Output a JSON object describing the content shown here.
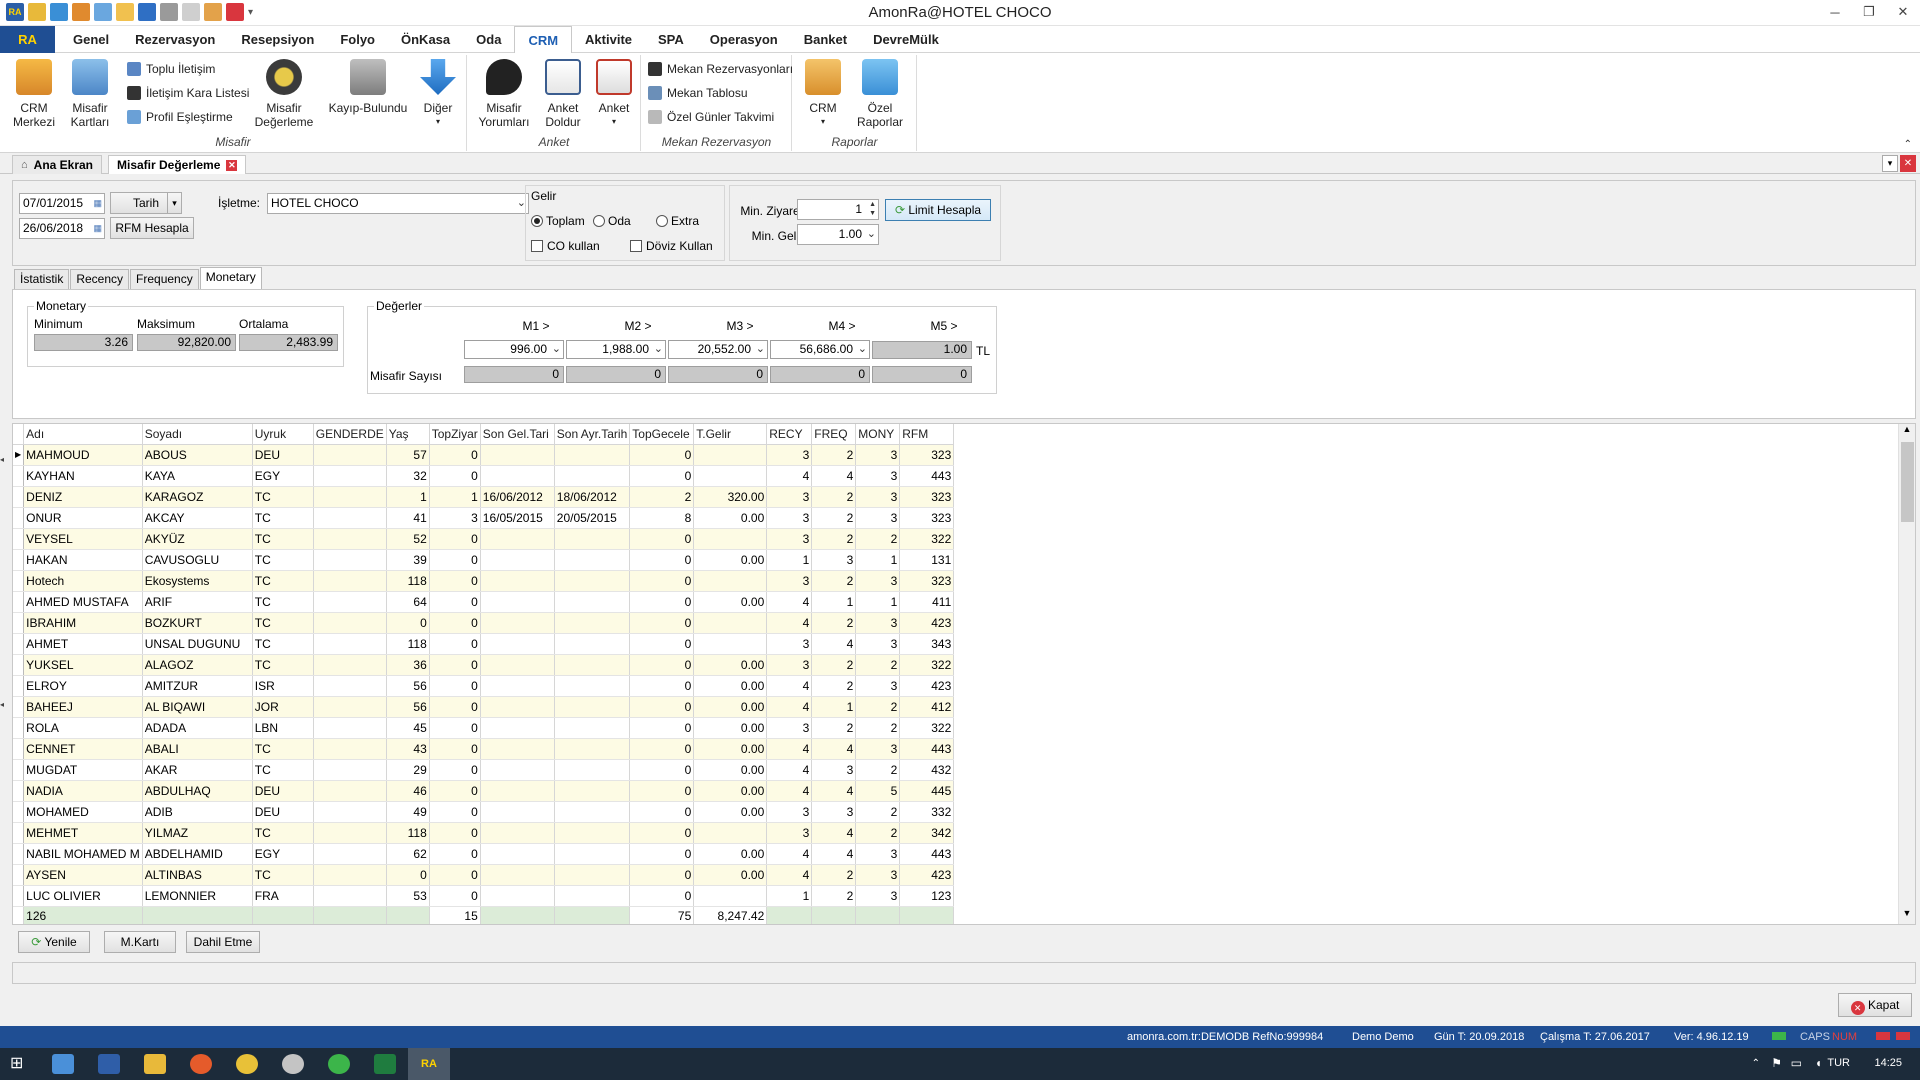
{
  "window": {
    "title": "AmonRa@HOTEL CHOCO",
    "app_logo": "RA"
  },
  "ribbon_tabs": [
    "Genel",
    "Rezervasyon",
    "Resepsiyon",
    "Folyo",
    "ÖnKasa",
    "Oda",
    "CRM",
    "Aktivite",
    "SPA",
    "Operasyon",
    "Banket",
    "DevreMülk"
  ],
  "active_tab": "CRM",
  "ribbon": {
    "misafir": {
      "label": "Misafir",
      "crm_merkezi": "CRM\nMerkezi",
      "misafir_kartlari": "Misafir\nKartları",
      "toplu_iletisim": "Toplu İletişim",
      "kara_liste": "İletişim Kara Listesi",
      "profil": "Profil Eşleştirme",
      "degerleme": "Misafir\nDeğerleme",
      "kayip": "Kayıp-Bulundu",
      "diger": "Diğer"
    },
    "anket": {
      "label": "Anket",
      "yorumlari": "Misafir\nYorumları",
      "doldur": "Anket\nDoldur",
      "anket": "Anket"
    },
    "mekan": {
      "label": "Mekan Rezervasyon",
      "rezervasyonlari": "Mekan Rezervasyonları",
      "tablosu": "Mekan Tablosu",
      "takvim": "Özel Günler Takvimi"
    },
    "raporlar": {
      "label": "Raporlar",
      "crm": "CRM",
      "ozel": "Özel\nRaporlar"
    }
  },
  "doc_tabs": {
    "home": "Ana Ekran",
    "current": "Misafir Değerleme"
  },
  "filter": {
    "date_from": "07/01/2015",
    "date_to": "26/06/2018",
    "date_type": "Tarih",
    "rfm_button": "RFM Hesapla",
    "isletme_label": "İşletme:",
    "isletme_value": "HOTEL CHOCO",
    "gelir_label": "Gelir",
    "gelir_options": [
      "Toplam",
      "Oda",
      "Extra"
    ],
    "gelir_selected": "Toplam",
    "co_kullan": "CO kullan",
    "doviz_kullan": "Döviz Kullan",
    "min_ziyaret_label": "Min. Ziyaret",
    "min_ziyaret": "1",
    "min_gelir_label": "Min. Gelir",
    "min_gelir": "1.00",
    "limit_button": "Limit Hesapla"
  },
  "sub_tabs": [
    "İstatistik",
    "Recency",
    "Frequency",
    "Monetary"
  ],
  "active_sub_tab": "Monetary",
  "monetary": {
    "title": "Monetary",
    "labels": [
      "Minimum",
      "Maksimum",
      "Ortalama"
    ],
    "values": [
      "3.26",
      "92,820.00",
      "2,483.99"
    ]
  },
  "degerler": {
    "title": "Değerler",
    "headers": [
      "M1 >",
      "M2 >",
      "M3 >",
      "M4 >",
      "M5 >"
    ],
    "thresholds": [
      "996.00",
      "1,988.00",
      "20,552.00",
      "56,686.00",
      "1.00"
    ],
    "currency": "TL",
    "count_label": "Misafir Sayısı",
    "counts": [
      "0",
      "0",
      "0",
      "0",
      "0"
    ]
  },
  "grid": {
    "columns": [
      "Adı",
      "Soyadı",
      "Uyruk",
      "GENDERDE",
      "Yaş",
      "TopZiyar",
      "Son Gel.Tari",
      "Son Ayr.Tarih",
      "TopGecele",
      "T.Gelir",
      "RECY",
      "FREQ",
      "MONY",
      "RFM"
    ],
    "rows": [
      [
        "MAHMOUD",
        "ABOUS",
        "DEU",
        "",
        "57",
        "0",
        "",
        "",
        "0",
        "",
        "3",
        "2",
        "3",
        "323"
      ],
      [
        "KAYHAN",
        "KAYA",
        "EGY",
        "",
        "32",
        "0",
        "",
        "",
        "0",
        "",
        "4",
        "4",
        "3",
        "443"
      ],
      [
        "DENIZ",
        "KARAGOZ",
        "TC",
        "",
        "1",
        "1",
        "16/06/2012",
        "18/06/2012",
        "2",
        "320.00",
        "3",
        "2",
        "3",
        "323"
      ],
      [
        "ONUR",
        "AKCAY",
        "TC",
        "",
        "41",
        "3",
        "16/05/2015",
        "20/05/2015",
        "8",
        "0.00",
        "3",
        "2",
        "3",
        "323"
      ],
      [
        "VEYSEL",
        "AKYÜZ",
        "TC",
        "",
        "52",
        "0",
        "",
        "",
        "0",
        "",
        "3",
        "2",
        "2",
        "322"
      ],
      [
        "HAKAN",
        "CAVUSOGLU",
        "TC",
        "",
        "39",
        "0",
        "",
        "",
        "0",
        "0.00",
        "1",
        "3",
        "1",
        "131"
      ],
      [
        "Hotech",
        "Ekosystems",
        "TC",
        "",
        "118",
        "0",
        "",
        "",
        "0",
        "",
        "3",
        "2",
        "3",
        "323"
      ],
      [
        "AHMED MUSTAFA",
        "ARIF",
        "TC",
        "",
        "64",
        "0",
        "",
        "",
        "0",
        "0.00",
        "4",
        "1",
        "1",
        "411"
      ],
      [
        "IBRAHIM",
        "BOZKURT",
        "TC",
        "",
        "0",
        "0",
        "",
        "",
        "0",
        "",
        "4",
        "2",
        "3",
        "423"
      ],
      [
        "AHMET",
        " UNSAL DUGUNU",
        "TC",
        "",
        "118",
        "0",
        "",
        "",
        "0",
        "",
        "3",
        "4",
        "3",
        "343"
      ],
      [
        "YUKSEL",
        "ALAGOZ",
        "TC",
        "",
        "36",
        "0",
        "",
        "",
        "0",
        "0.00",
        "3",
        "2",
        "2",
        "322"
      ],
      [
        "ELROY",
        "AMITZUR",
        "ISR",
        "",
        "56",
        "0",
        "",
        "",
        "0",
        "0.00",
        "4",
        "2",
        "3",
        "423"
      ],
      [
        "BAHEEJ",
        "AL BIQAWI",
        "JOR",
        "",
        "56",
        "0",
        "",
        "",
        "0",
        "0.00",
        "4",
        "1",
        "2",
        "412"
      ],
      [
        "ROLA",
        "ADADA",
        "LBN",
        "",
        "45",
        "0",
        "",
        "",
        "0",
        "0.00",
        "3",
        "2",
        "2",
        "322"
      ],
      [
        "CENNET",
        "ABALI",
        "TC",
        "",
        "43",
        "0",
        "",
        "",
        "0",
        "0.00",
        "4",
        "4",
        "3",
        "443"
      ],
      [
        "MUGDAT",
        "AKAR",
        "TC",
        "",
        "29",
        "0",
        "",
        "",
        "0",
        "0.00",
        "4",
        "3",
        "2",
        "432"
      ],
      [
        "NADIA",
        "ABDULHAQ",
        "DEU",
        "",
        "46",
        "0",
        "",
        "",
        "0",
        "0.00",
        "4",
        "4",
        "5",
        "445"
      ],
      [
        "MOHAMED",
        "ADIB",
        "DEU",
        "",
        "49",
        "0",
        "",
        "",
        "0",
        "0.00",
        "3",
        "3",
        "2",
        "332"
      ],
      [
        "MEHMET",
        " YILMAZ",
        "TC",
        "",
        "118",
        "0",
        "",
        "",
        "0",
        "",
        "3",
        "4",
        "2",
        "342"
      ],
      [
        "NABIL MOHAMED M",
        "ABDELHAMID",
        "EGY",
        "",
        "62",
        "0",
        "",
        "",
        "0",
        "0.00",
        "4",
        "4",
        "3",
        "443"
      ],
      [
        "AYSEN",
        "ALTINBAS",
        "TC",
        "",
        "0",
        "0",
        "",
        "",
        "0",
        "0.00",
        "4",
        "2",
        "3",
        "423"
      ],
      [
        "LUC OLIVIER",
        "LEMONNIER",
        "FRA",
        "",
        "53",
        "0",
        "",
        "",
        "0",
        "",
        "1",
        "2",
        "3",
        "123"
      ]
    ],
    "footer": {
      "count": "126",
      "top_ziyaret": "15",
      "top_gecele": "75",
      "t_gelir": "8,247.42"
    }
  },
  "buttons": {
    "yenile": "Yenile",
    "m_karti": "M.Kartı",
    "dahil_etme": "Dahil Etme",
    "kapat": "Kapat"
  },
  "statusbar": {
    "db": "amonra.com.tr:DEMODB RefNo:999984",
    "user": "Demo Demo",
    "gun": "Gün T: 20.09.2018",
    "calisma": "Çalışma T: 27.06.2017",
    "ver": "Ver: 4.96.12.19",
    "caps": "CAPS",
    "num": "NUM"
  },
  "taskbar": {
    "lang": "TUR",
    "time": "14:25",
    "active_app": "RA"
  }
}
